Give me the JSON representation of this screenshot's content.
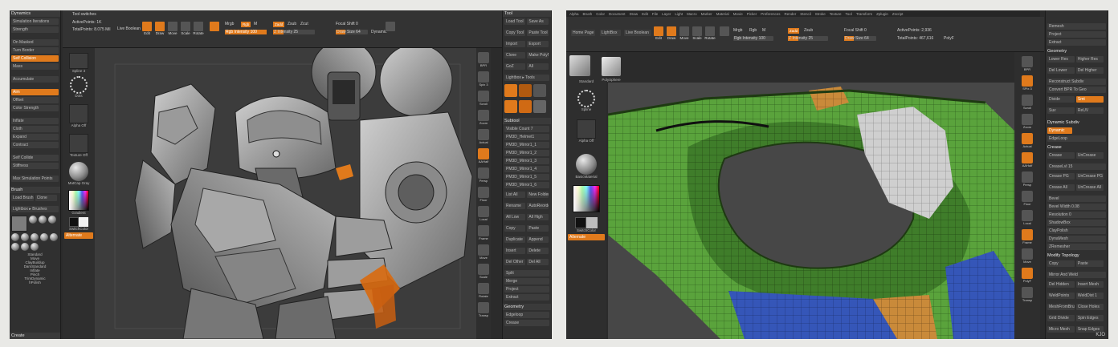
{
  "left": {
    "dynamics_panel": {
      "title": "Dynamics",
      "rows": [
        "Simulation Iterations",
        "Strength",
        "On Masked",
        "Turn Border",
        "Self Collision",
        "Mass",
        "Accumulate",
        "Aim",
        "Offset",
        "Color Strength",
        "Inflate",
        "Cloth",
        "Expand",
        "Contract",
        "Self Collide",
        "Stiffness",
        "Max Simulation Points"
      ]
    },
    "brush_panel": {
      "title": "Brush",
      "rows": [
        "Load Brush",
        "Clone",
        "Lightbox ▸ Brushes",
        "Standard",
        "Move",
        "ClayBuildup",
        "DamStandard",
        "Inflate",
        "Pinch",
        "TrimDynamic",
        "hPolish",
        "Create"
      ]
    },
    "top": {
      "title": "Tool switches",
      "active_points": "ActivePoints: 1K",
      "total_points": "TotalPoints: 8.075 Mil",
      "live_boolean": "Live Boolean",
      "buttons": [
        "Edit",
        "Draw",
        "Move",
        "Scale",
        "Rotate"
      ],
      "mrgb": "Mrgb",
      "rgb": "Rgb",
      "m": "M",
      "zadd": "Zadd",
      "zsub": "Zsub",
      "zcut": "Zcut",
      "rgb_intensity": "Rgb Intensity 100",
      "z_intensity": "Z Intensity 25",
      "focal_shift": "Focal Shift 0",
      "draw_size": "Draw Size 64",
      "dynamic": "Dynamic"
    },
    "left_shelf": {
      "items": [
        "Spline 3",
        "Dots",
        "Alpha Off",
        "Texture Off",
        "MatCap Gray",
        "Gradient",
        "SwitchColor",
        "Alternate"
      ]
    },
    "right_shelf": {
      "items": [
        "BPR",
        "Spix 3",
        "Scroll",
        "Zoom",
        "Actual",
        "AAHalf",
        "Persp",
        "Floor",
        "Local",
        "Frame",
        "Move",
        "Scale",
        "Rotate",
        "Transp",
        "Ghost",
        "Solo",
        "Xpose"
      ]
    },
    "tool_panel": {
      "title": "Tool",
      "rows": [
        "Load Tool",
        "Save As",
        "Copy Tool",
        "Paste Tool",
        "Import",
        "Export",
        "Clone",
        "Make PolyMesh3D",
        "GoZ",
        "All",
        "Visible",
        "Lightbox ▸ Tools"
      ],
      "subtool_title": "Subtool",
      "visible_count": "Visible Count 7",
      "subtools": [
        "PM3D_Helmet1",
        "PM3D_Mirror1_1",
        "PM3D_Mirror1_2",
        "PM3D_Mirror1_3",
        "PM3D_Mirror1_4",
        "PM3D_Mirror1_5",
        "PM3D_Mirror1_6"
      ],
      "list_all": "List All",
      "new_folder": "New Folder",
      "rows2": [
        "Rename",
        "AutoReorder",
        "All Low",
        "All High",
        "Copy",
        "Paste",
        "Duplicate",
        "Append",
        "Insert",
        "Delete",
        "Del Other",
        "Del All",
        "Split",
        "Merge",
        "Project",
        "Extract"
      ],
      "geometry_title": "Geometry",
      "geometry_rows": [
        "Edgeloop",
        "Crease"
      ]
    }
  },
  "right": {
    "top": {
      "menu": [
        "Alpha",
        "Brush",
        "Color",
        "Document",
        "Draw",
        "Edit",
        "File",
        "Layer",
        "Light",
        "Macro",
        "Marker",
        "Material",
        "Movie",
        "Picker",
        "Preferences",
        "Render",
        "Stencil",
        "Stroke",
        "Texture",
        "Tool",
        "Transform",
        "Zplugin",
        "Zscript"
      ],
      "home": "Home Page",
      "lightbox": "LightBox",
      "live_boolean": "Live Boolean",
      "buttons": [
        "Edit",
        "Draw",
        "Move",
        "Scale",
        "Rotate"
      ],
      "mrgb": "Mrgb",
      "rgb": "Rgb",
      "m": "M",
      "zadd": "Zadd",
      "zsub": "Zsub",
      "rgb_intensity": "Rgb Intensity 100",
      "z_intensity": "Z Intensity 25",
      "focal_shift": "Focal Shift 0",
      "draw_size": "Draw Size 64",
      "active_points": "ActivePoints: 2,936",
      "total_points": "TotalPoints: 467,616",
      "polyf": "PolyF"
    },
    "left_shelf": {
      "items": [
        "Standard",
        "PolySphere",
        "Spline",
        "Alpha Off",
        "Texture Off",
        "BasicMaterial",
        "SwitchColor",
        "Alternate"
      ]
    },
    "right_shelf": {
      "items": [
        "BPR",
        "SPix 3",
        "Scroll",
        "Zoom",
        "Actual",
        "AAHalf",
        "Persp",
        "Floor",
        "Local",
        "Frame",
        "Move",
        "Scale",
        "Rotate",
        "PolyF",
        "Transp",
        "Solo",
        "Xpose"
      ]
    },
    "tool_panel": {
      "rows_top": [
        "Remesh",
        "Project",
        "Extract"
      ],
      "geometry_title": "Geometry",
      "rows": [
        "Lower Res",
        "Higher Res",
        "Del Lower",
        "Del Higher",
        "Reconstruct Subdiv",
        "Convert BPR To Geo",
        "Divide",
        "Smt",
        "Suv",
        "ReUV"
      ],
      "dynamic_subdiv": "Dynamic Subdiv",
      "dynamic": "Dynamic",
      "edgeloop": "EdgeLoop",
      "crease_title": "Crease",
      "crease_rows": [
        "Crease",
        "UnCrease",
        "CreaseLvl 15",
        "Crease PG",
        "UnCrease PG",
        "Crease All",
        "UnCrease All",
        "Bevel",
        "Bevel Width 0.08",
        "Resolution 0"
      ],
      "more_rows": [
        "ShadowBox",
        "ClayPolish",
        "DynaMesh",
        "ZRemesher"
      ],
      "modify_title": "Modify Topology",
      "modify_rows": [
        "Copy",
        "Paste",
        "Mirror And Weld",
        "Del Hidden",
        "Insert Mesh",
        "WeldPoints",
        "WeldDist 1",
        "MeshFromBrush",
        "Close Holes",
        "Grid Divide",
        "Spin Edges",
        "Micro Mesh",
        "Snap Edges"
      ]
    },
    "watermark": "KJO"
  },
  "colors": {
    "accent": "#e07a1c",
    "panel": "#303030",
    "mesh_green": "#5aa33c",
    "mesh_blue": "#3556b8",
    "mesh_grey": "#cfcfcf"
  }
}
